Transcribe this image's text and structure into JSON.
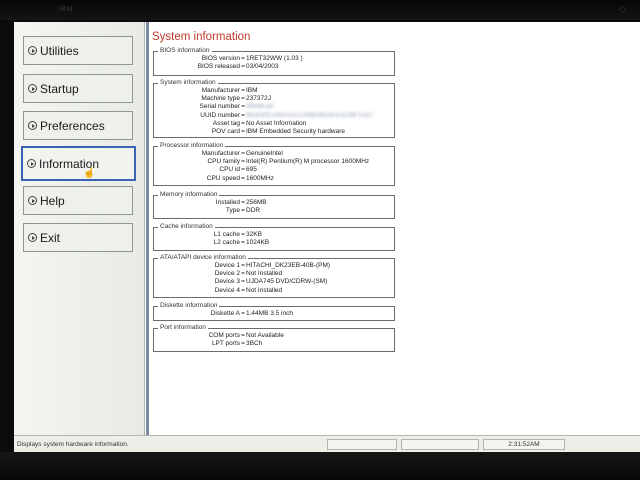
{
  "bezel": {
    "logo": "IBM",
    "corner": "◇"
  },
  "menu": {
    "items": [
      {
        "label": "Utilities"
      },
      {
        "label": "Startup"
      },
      {
        "label": "Preferences"
      },
      {
        "label": "Information"
      },
      {
        "label": "Help"
      },
      {
        "label": "Exit"
      }
    ],
    "active": "Information"
  },
  "page_title": "System information",
  "groups": [
    {
      "title": "BIOS information",
      "rows": [
        {
          "k": "BIOS version",
          "v": "1RET32WW (1.03 )"
        },
        {
          "k": "BIOS released",
          "v": "03/04/2003"
        }
      ]
    },
    {
      "title": "System information",
      "rows": [
        {
          "k": "Manufacturer",
          "v": "IBM"
        },
        {
          "k": "Machine type",
          "v": "237372J"
        },
        {
          "k": "Serial number",
          "v": "99MBL82"
        },
        {
          "k": "UUID number",
          "v": "B53DEE1455A311CBBE9EDE41E2BF1437"
        },
        {
          "k": "Asset tag",
          "v": "No Asset Information"
        },
        {
          "k": "POV card",
          "v": "IBM Embedded Security hardware"
        }
      ]
    },
    {
      "title": "Processor information",
      "rows": [
        {
          "k": "Manufacturer",
          "v": "GenuineIntel"
        },
        {
          "k": "CPU family",
          "v": "Intel(R) Pentium(R) M processor 1600MHz"
        },
        {
          "k": "CPU id",
          "v": "695"
        },
        {
          "k": "CPU speed",
          "v": "1600MHz"
        }
      ]
    },
    {
      "title": "Memory information",
      "rows": [
        {
          "k": "Installed",
          "v": "256MB"
        },
        {
          "k": "Type",
          "v": "DDR"
        }
      ]
    },
    {
      "title": "Cache information",
      "rows": [
        {
          "k": "L1 cache",
          "v": "32KB"
        },
        {
          "k": "L2 cache",
          "v": "1024KB"
        }
      ]
    },
    {
      "title": "ATA/ATAPI device information",
      "rows": [
        {
          "k": "Device 1",
          "v": "HITACHI_DK23EB-40B-(PM)"
        },
        {
          "k": "Device 2",
          "v": "Not Installed"
        },
        {
          "k": "Device 3",
          "v": "UJDA745 DVD/CDRW-(SM)"
        },
        {
          "k": "Device 4",
          "v": "Not Installed"
        }
      ]
    },
    {
      "title": "Diskette information",
      "rows": [
        {
          "k": "Diskette A",
          "v": "1.44MB 3.5 inch"
        }
      ]
    },
    {
      "title": "Port information",
      "rows": [
        {
          "k": "COM ports",
          "v": "Not Available"
        },
        {
          "k": "LPT ports",
          "v": "3BCh"
        }
      ]
    }
  ],
  "status": {
    "message": "Displays system hardware information.",
    "time": "2:31:52AM"
  },
  "colors": {
    "title": "#c0392b",
    "active_border": "#3a63b7",
    "divider": "#7d8aa3"
  }
}
